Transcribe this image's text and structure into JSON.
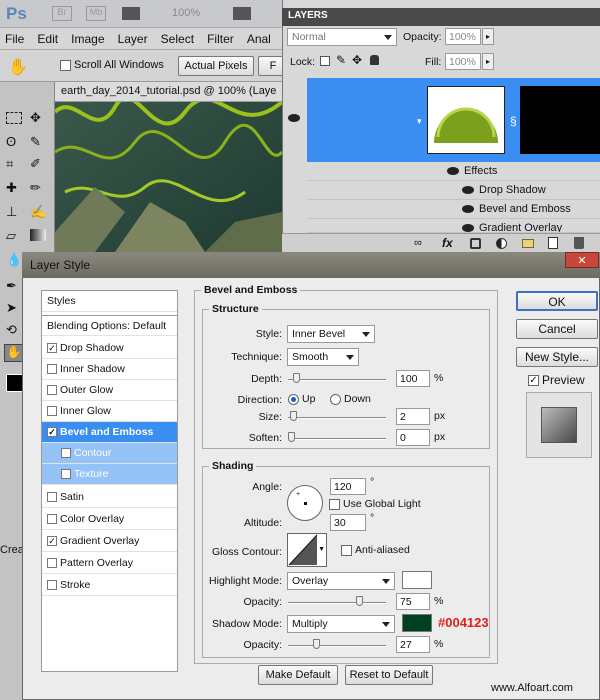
{
  "app": {
    "logo": "Ps",
    "top_icons": [
      "Br",
      "Mb"
    ],
    "zoom": "100%",
    "menu": [
      "File",
      "Edit",
      "Image",
      "Layer",
      "Select",
      "Filter",
      "Anal"
    ],
    "options": {
      "scroll_all_windows": "Scroll All Windows",
      "actual_pixels": "Actual Pixels",
      "f_button": "F"
    },
    "doc_title": "earth_day_2014_tutorial.psd @ 100% (Laye",
    "side_text": "Crea"
  },
  "layers": {
    "header": "LAYERS",
    "blend_mode": "Normal",
    "opacity_label": "Opacity:",
    "opacity_value": "100%",
    "lock_label": "Lock:",
    "fill_label": "Fill:",
    "fill_value": "100%",
    "effects": [
      "Effects",
      "Drop Shadow",
      "Bevel and Emboss",
      "Gradient Overlay"
    ],
    "bottom_icons": [
      "link-icon",
      "fx-icon",
      "mask-icon",
      "adjustment-icon",
      "group-icon",
      "new-layer-icon",
      "trash-icon"
    ],
    "fx_glyph": "fx"
  },
  "dialog": {
    "title": "Layer Style",
    "close_glyph": "✕",
    "styles": [
      {
        "label": "Styles",
        "checkbox": false,
        "checked": false
      },
      {
        "label": "Blending Options: Default",
        "checkbox": false,
        "checked": false
      },
      {
        "label": "Drop Shadow",
        "checkbox": true,
        "checked": true
      },
      {
        "label": "Inner Shadow",
        "checkbox": true,
        "checked": false
      },
      {
        "label": "Outer Glow",
        "checkbox": true,
        "checked": false
      },
      {
        "label": "Inner Glow",
        "checkbox": true,
        "checked": false
      },
      {
        "label": "Bevel and Emboss",
        "checkbox": true,
        "checked": true,
        "selected": true
      },
      {
        "label": "Contour",
        "checkbox": true,
        "checked": false,
        "sub": true
      },
      {
        "label": "Texture",
        "checkbox": true,
        "checked": false,
        "sub": true
      },
      {
        "label": "Satin",
        "checkbox": true,
        "checked": false
      },
      {
        "label": "Color Overlay",
        "checkbox": true,
        "checked": false
      },
      {
        "label": "Gradient Overlay",
        "checkbox": true,
        "checked": true
      },
      {
        "label": "Pattern Overlay",
        "checkbox": true,
        "checked": false
      },
      {
        "label": "Stroke",
        "checkbox": true,
        "checked": false
      }
    ],
    "bevel": {
      "title": "Bevel and Emboss",
      "structure": "Structure",
      "style_label": "Style:",
      "style_value": "Inner Bevel",
      "technique_label": "Technique:",
      "technique_value": "Smooth",
      "depth_label": "Depth:",
      "depth_value": "100",
      "depth_unit": "%",
      "direction_label": "Direction:",
      "dir_up": "Up",
      "dir_down": "Down",
      "size_label": "Size:",
      "size_value": "2",
      "size_unit": "px",
      "soften_label": "Soften:",
      "soften_value": "0",
      "soften_unit": "px",
      "shading": "Shading",
      "angle_label": "Angle:",
      "angle_value": "120",
      "angle_unit": "°",
      "global_light": "Use Global Light",
      "altitude_label": "Altitude:",
      "altitude_value": "30",
      "altitude_unit": "°",
      "gloss_label": "Gloss Contour:",
      "anti_aliased": "Anti-aliased",
      "highlight_label": "Highlight Mode:",
      "highlight_value": "Overlay",
      "highlight_opacity_label": "Opacity:",
      "highlight_opacity": "75",
      "highlight_unit": "%",
      "shadow_label": "Shadow Mode:",
      "shadow_value": "Multiply",
      "shadow_color": "#004123",
      "shadow_opacity_label": "Opacity:",
      "shadow_opacity": "27",
      "shadow_unit": "%",
      "make_default": "Make Default",
      "reset_default": "Reset to Default"
    },
    "levels": {
      "depth": 0.05,
      "size": 0.02,
      "soften": 0.0,
      "highlight_opacity": 0.75,
      "shadow_opacity": 0.27
    },
    "buttons": {
      "ok": "OK",
      "cancel": "Cancel",
      "new_style": "New Style...",
      "preview": "Preview"
    }
  },
  "watermark": "www.Alfoart.com",
  "colors": {
    "selection": "#3a8ef2",
    "shadow": "#004123",
    "annotation": "#e0201b"
  }
}
